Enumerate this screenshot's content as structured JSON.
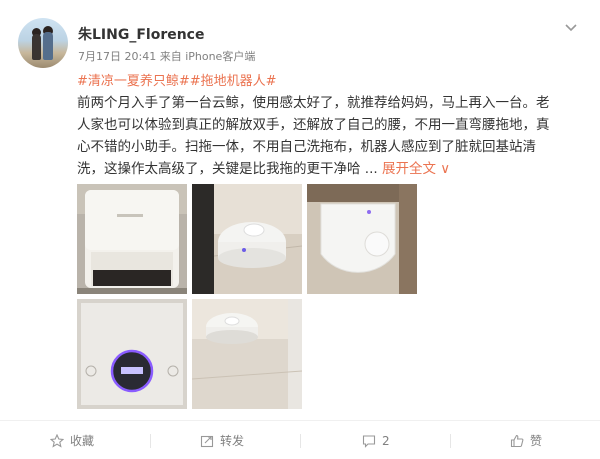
{
  "post": {
    "username": "朱LING_Florence",
    "date": "7月17日 20:41",
    "source": "来自 iPhone客户端",
    "tags": "#清凉一夏养只鲸##拖地机器人#",
    "content_lines": [
      "前两个月入手了第一台云鲸，使用感太好了，就推荐给妈妈，马上再入一台。老",
      "人家也可以体验到真正的解放双手，还解放了自己的腰，不用一直弯腰拖地，真",
      "心不错的小助手。扫拖一体，不用自己洗拖布，机器人感应到了脏就回基站清",
      "洗，这操作太高级了，关键是比我拖的更干净哈 ... "
    ],
    "expand_label": "展开全文",
    "expand_arrow": "∨"
  },
  "images": [
    {
      "name": "base-station",
      "alt": "云鲸基站"
    },
    {
      "name": "robot-floor",
      "alt": "扫拖机器人在地板上"
    },
    {
      "name": "robot-top-view",
      "alt": "机器人俯视图"
    },
    {
      "name": "control-panel",
      "alt": "基站控制面板"
    },
    {
      "name": "robot-docked",
      "alt": "机器人靠近基站"
    }
  ],
  "actions": {
    "favorite_label": "收藏",
    "repost_label": "转发",
    "comment_count": "2",
    "like_label": "赞"
  },
  "icons": [
    "more-chevron-icon",
    "star-icon",
    "repost-icon",
    "comment-icon",
    "like-icon"
  ],
  "colors": {
    "accent": "#eb7350",
    "text": "#333333",
    "meta": "#808080"
  }
}
